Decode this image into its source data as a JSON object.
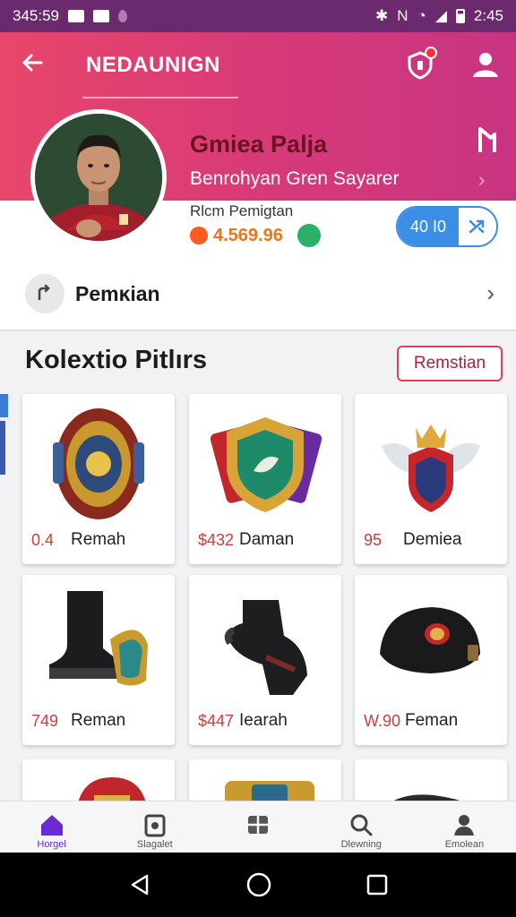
{
  "status_bar": {
    "time_left": "345:59",
    "time_right": "2:45"
  },
  "header": {
    "title": "NEDAUNIGN",
    "back_icon": "arrow-left-icon",
    "shield_icon": "shield-icon",
    "user_icon": "user-icon"
  },
  "profile": {
    "name": "Gmiea Palja",
    "subtitle": "Benrohyan Gren Sayarer",
    "meta": "Rlcm Pemigtan",
    "coins": "4.569.96",
    "pill_label": "40 I0"
  },
  "row": {
    "label": "Pemĸian"
  },
  "collection": {
    "title": "Kolextio Pitlırs",
    "action_label": "Remstian",
    "items": [
      {
        "price": "0.4",
        "name": "Remah"
      },
      {
        "price": "$432",
        "name": "Daman"
      },
      {
        "price": "95",
        "name": "Demiea"
      },
      {
        "price": "749",
        "name": "Reman"
      },
      {
        "price": "$447",
        "name": "Iearah"
      },
      {
        "price": "W.90",
        "name": "Feman"
      }
    ]
  },
  "bottom_nav": [
    {
      "label": "Horgel"
    },
    {
      "label": "Slagalet"
    },
    {
      "label": ""
    },
    {
      "label": "Dlewning"
    },
    {
      "label": "Emolean"
    }
  ],
  "colors": {
    "brand": "#d83a78",
    "accent_blue": "#3b8ee6",
    "price_red": "#d23b3b",
    "coin_orange": "#e8761c",
    "nav_active": "#6a2bd0"
  }
}
